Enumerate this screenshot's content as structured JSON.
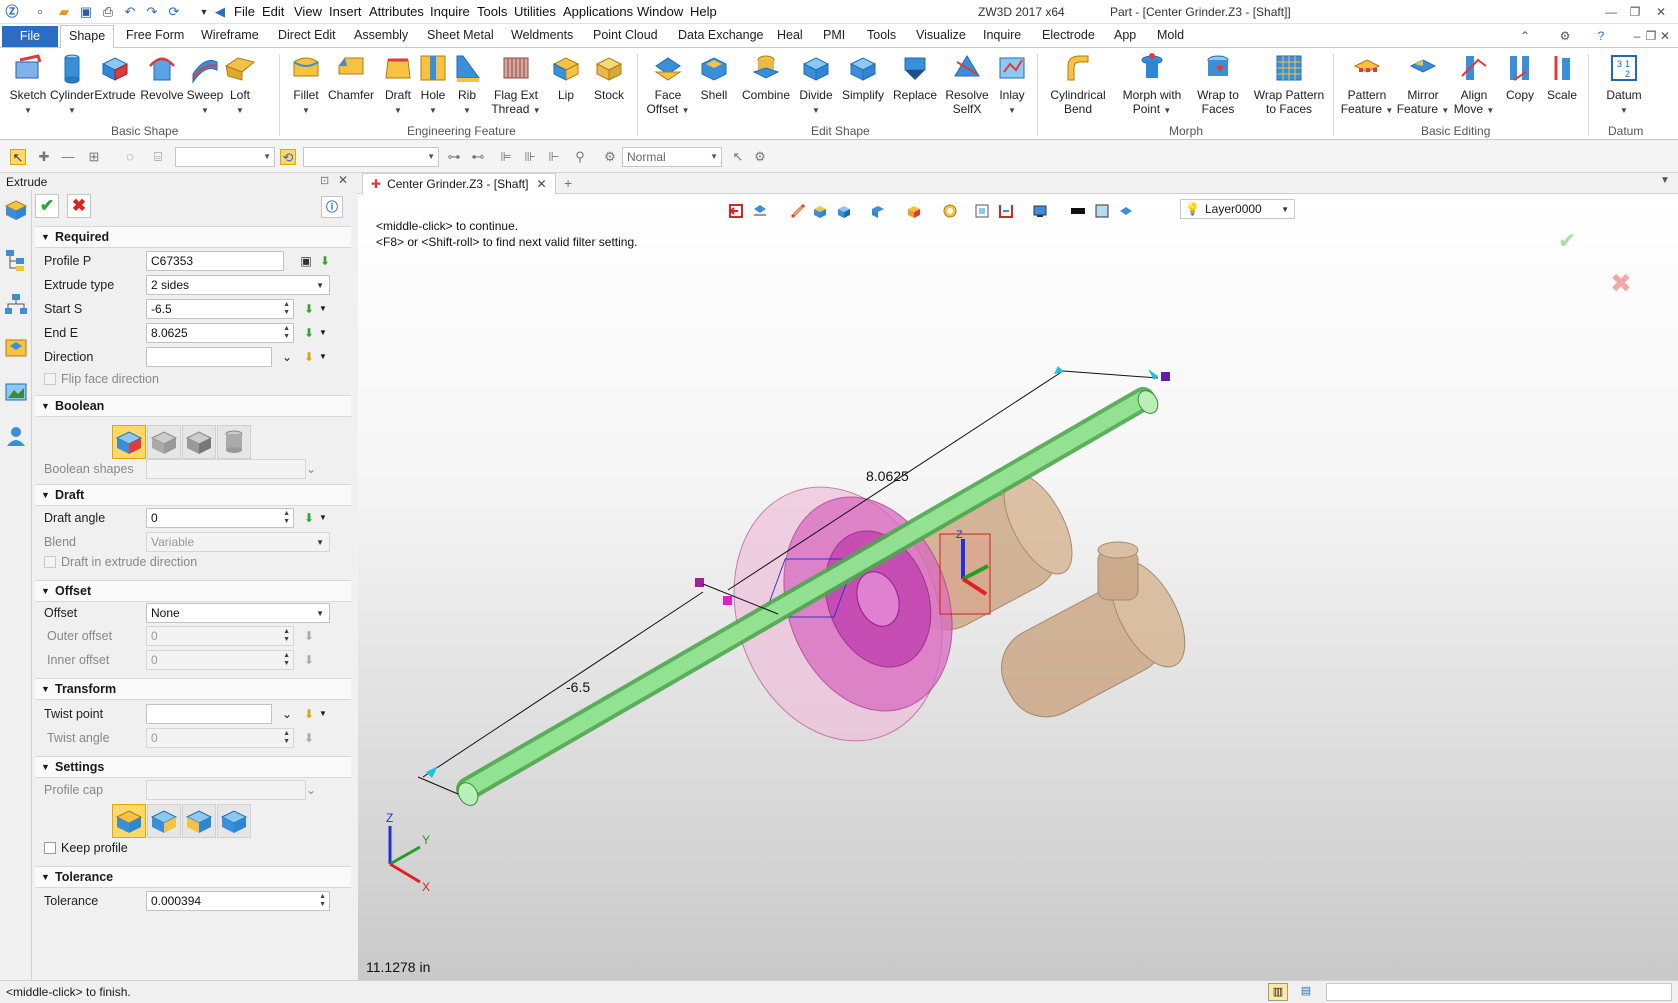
{
  "titlebar": {
    "menus": [
      "File",
      "Edit",
      "View",
      "Insert",
      "Attributes",
      "Inquire",
      "Tools",
      "Utilities",
      "Applications",
      "Window",
      "Help"
    ],
    "app_name": "ZW3D 2017  x64",
    "doc_title": "Part - [Center Grinder.Z3 - [Shaft]]"
  },
  "ribbon_tabs": {
    "file": "File",
    "tabs": [
      "Shape",
      "Free Form",
      "Wireframe",
      "Direct Edit",
      "Assembly",
      "Sheet Metal",
      "Weldments",
      "Point Cloud",
      "Data Exchange",
      "Heal",
      "PMI",
      "Tools",
      "Visualize",
      "Inquire",
      "Electrode",
      "App",
      "Mold"
    ],
    "active": "Shape"
  },
  "ribbon": {
    "basic_shape": {
      "label": "Basic Shape",
      "buttons": [
        {
          "l1": "Sketch",
          "l2": ""
        },
        {
          "l1": "Cylinder",
          "l2": ""
        },
        {
          "l1": "Extrude",
          "l2": ""
        },
        {
          "l1": "Revolve",
          "l2": ""
        },
        {
          "l1": "Sweep",
          "l2": ""
        },
        {
          "l1": "Loft",
          "l2": ""
        }
      ]
    },
    "engineering_feature": {
      "label": "Engineering Feature",
      "buttons": [
        {
          "l1": "Fillet",
          "l2": ""
        },
        {
          "l1": "Chamfer",
          "l2": ""
        },
        {
          "l1": "Draft",
          "l2": ""
        },
        {
          "l1": "Hole",
          "l2": ""
        },
        {
          "l1": "Rib",
          "l2": ""
        },
        {
          "l1": "Flag Ext",
          "l2": "Thread"
        },
        {
          "l1": "Lip",
          "l2": ""
        },
        {
          "l1": "Stock",
          "l2": ""
        }
      ]
    },
    "edit_shape": {
      "label": "Edit Shape",
      "buttons": [
        {
          "l1": "Face",
          "l2": "Offset"
        },
        {
          "l1": "Shell",
          "l2": ""
        },
        {
          "l1": "Combine",
          "l2": ""
        },
        {
          "l1": "Divide",
          "l2": ""
        },
        {
          "l1": "Simplify",
          "l2": ""
        },
        {
          "l1": "Replace",
          "l2": ""
        },
        {
          "l1": "Resolve",
          "l2": "SelfX"
        },
        {
          "l1": "Inlay",
          "l2": ""
        }
      ]
    },
    "morph": {
      "label": "Morph",
      "buttons": [
        {
          "l1": "Cylindrical",
          "l2": "Bend"
        },
        {
          "l1": "Morph with",
          "l2": "Point"
        },
        {
          "l1": "Wrap to",
          "l2": "Faces"
        },
        {
          "l1": "Wrap Pattern",
          "l2": "to Faces"
        }
      ]
    },
    "basic_editing": {
      "label": "Basic Editing",
      "buttons": [
        {
          "l1": "Pattern",
          "l2": "Feature"
        },
        {
          "l1": "Mirror",
          "l2": "Feature"
        },
        {
          "l1": "Align",
          "l2": "Move"
        },
        {
          "l1": "Copy",
          "l2": ""
        },
        {
          "l1": "Scale",
          "l2": ""
        }
      ]
    },
    "datum": {
      "label": "Datum",
      "buttons": [
        {
          "l1": "Datum",
          "l2": ""
        }
      ]
    }
  },
  "toolbar2": {
    "render_mode": "Normal"
  },
  "panel": {
    "title": "Extrude",
    "required": {
      "header": "Required",
      "profile_label": "Profile P",
      "profile_value": "C67353",
      "extrude_type_label": "Extrude type",
      "extrude_type_value": "2 sides",
      "start_label": "Start S",
      "start_value": "-6.5",
      "end_label": "End E",
      "end_value": "8.0625",
      "direction_label": "Direction",
      "direction_value": "",
      "flip_label": "Flip face direction"
    },
    "boolean": {
      "header": "Boolean",
      "shapes_label": "Boolean shapes"
    },
    "draft": {
      "header": "Draft",
      "angle_label": "Draft angle",
      "angle_value": "0",
      "blend_label": "Blend",
      "blend_value": "Variable",
      "extrude_dir_label": "Draft in extrude direction"
    },
    "offset": {
      "header": "Offset",
      "offset_label": "Offset",
      "offset_value": "None",
      "outer_label": "Outer offset",
      "outer_value": "0",
      "inner_label": "Inner offset",
      "inner_value": "0"
    },
    "transform": {
      "header": "Transform",
      "twist_point_label": "Twist point",
      "twist_point_value": "",
      "twist_angle_label": "Twist angle",
      "twist_angle_value": "0"
    },
    "settings": {
      "header": "Settings",
      "profile_cap_label": "Profile cap",
      "keep_profile_label": "Keep profile"
    },
    "tolerance": {
      "header": "Tolerance",
      "tolerance_label": "Tolerance",
      "tolerance_value": "0.000394"
    }
  },
  "document": {
    "tab_label": "Center Grinder.Z3 - [Shaft]",
    "layer": "Layer0000",
    "hint1": "<middle-click> to continue.",
    "hint2": "<F8> or <Shift-roll> to find next valid filter setting.",
    "dim_end": "8.0625",
    "dim_start": "-6.5",
    "axis_x": "X",
    "axis_y": "Y",
    "axis_z": "Z",
    "measure": "11.1278 in"
  },
  "status": {
    "text": "<middle-click> to finish."
  }
}
